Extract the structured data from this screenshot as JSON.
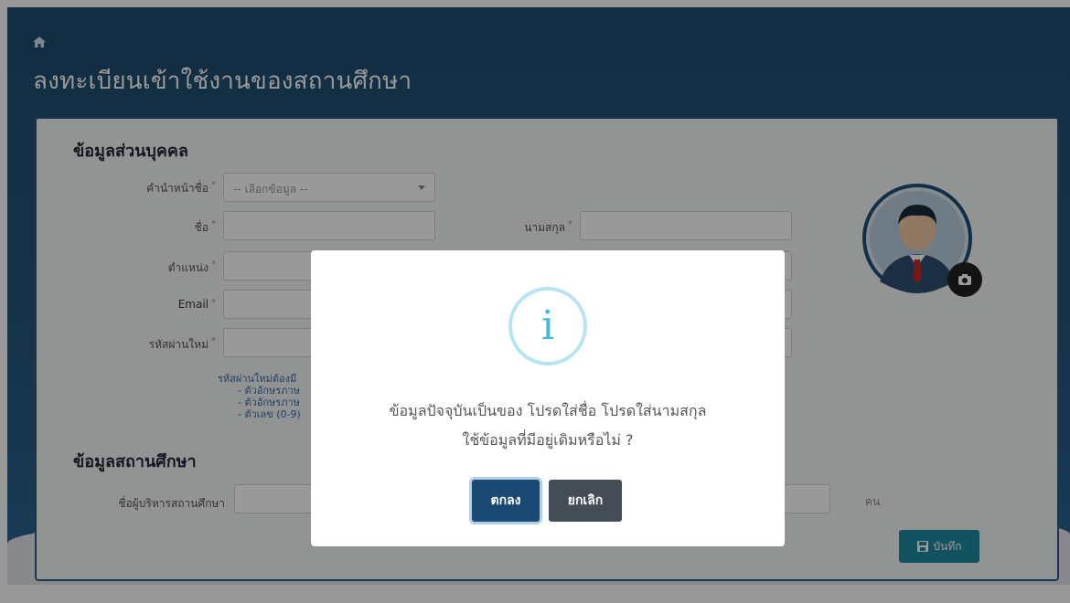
{
  "page": {
    "title": "ลงทะเบียนเข้าใช้งานของสถานศึกษา",
    "home_icon": "home-icon"
  },
  "personal_section": {
    "title": "ข้อมูลส่วนบุคคล",
    "fields": {
      "prefix": {
        "label": "คำนำหน้าชื่อ",
        "required": "*",
        "value": "-- เลือกข้อมูล --"
      },
      "first_name": {
        "label": "ชื่อ",
        "required": "*",
        "value": ""
      },
      "last_name": {
        "label": "นามสกุล",
        "required": "*",
        "value": ""
      },
      "position": {
        "label": "ตำแหน่ง",
        "required": "*",
        "value": ""
      },
      "email": {
        "label": "Email",
        "required": "*",
        "value": ""
      },
      "new_password": {
        "label": "รหัสผ่านใหม่",
        "required": "*",
        "value": ""
      }
    },
    "password_hint": {
      "heading": "รหัสผ่านใหม่ต้องมี",
      "rules": [
        "- ตัวอักษรภาษ",
        "- ตัวอักษรภาษ",
        "- ตัวเลข (0-9)"
      ]
    }
  },
  "school_section": {
    "title": "ข้อมูลสถานศึกษา",
    "fields": {
      "director_name": {
        "label": "ชื่อผู้บริหารสถานศึกษา",
        "value": ""
      },
      "count_unit": "คน"
    }
  },
  "avatar": {
    "icon": "user-avatar-icon",
    "camera_icon": "camera-icon"
  },
  "save_button": {
    "label": "บันทึก",
    "icon": "save-icon"
  },
  "modal": {
    "icon": "info-icon",
    "glyph": "i",
    "message_line1": "ข้อมูลปัจจุบันเป็นของ โปรดใส่ชื่อ โปรดใส่นามสกุล",
    "message_line2": "ใช้ข้อมูลที่มีอยู่เดิมหรือไม่ ?",
    "confirm_label": "ตกลง",
    "cancel_label": "ยกเลิก"
  },
  "colors": {
    "header_bg": "#24557a",
    "info_accent": "#3fb6e4",
    "confirm_bg": "#1a4a74",
    "cancel_bg": "#444c56",
    "save_bg": "#1f8a9e"
  }
}
